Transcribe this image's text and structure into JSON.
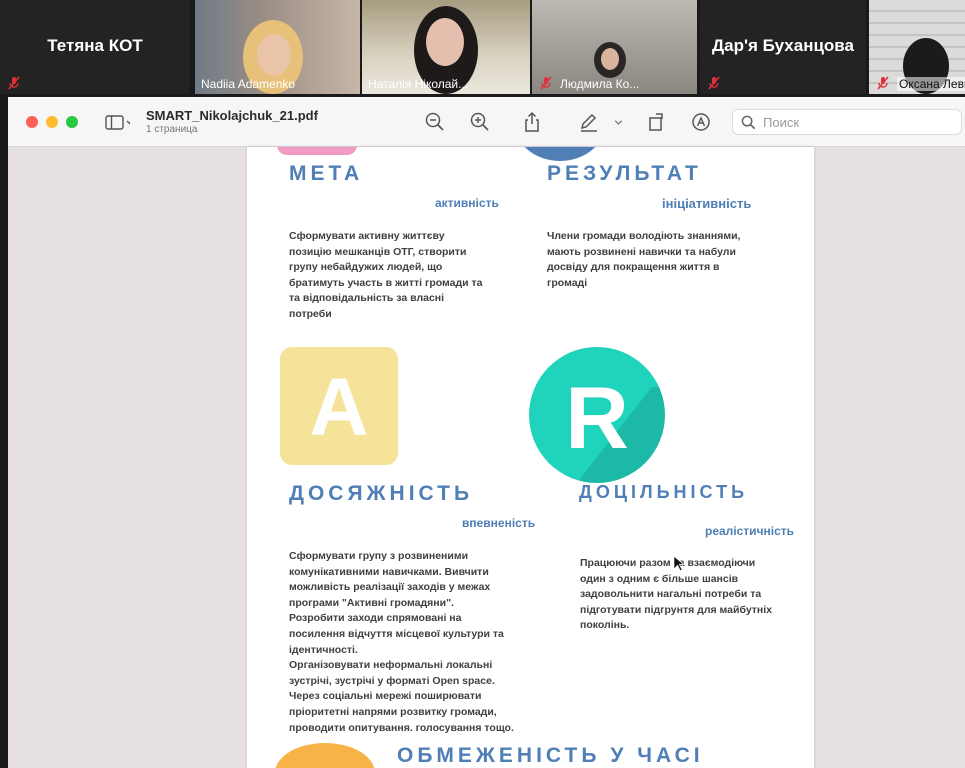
{
  "participants": [
    {
      "name": "Тетяна КОТ",
      "video": false,
      "muted": true
    },
    {
      "name": "Nadiia Adamenko",
      "video": true,
      "muted": false
    },
    {
      "name": "Наталія Ніколай...",
      "video": true,
      "muted": false,
      "active": true
    },
    {
      "name": "Людмила Ко...",
      "video": true,
      "muted": true
    },
    {
      "name": "Дар'я Буханцова",
      "video": false,
      "muted": true
    },
    {
      "name": "Оксана Леви",
      "video": true,
      "muted": true
    }
  ],
  "window": {
    "file_name": "SMART_Nikolajchuk_21.pdf",
    "page_count": "1 страница",
    "search_placeholder": "Поиск"
  },
  "doc": {
    "sections": {
      "meta": {
        "heading": "МЕТА",
        "keyword": "активність",
        "lines": [
          "Сформувати активну життєву",
          "позицію мешканців ОТГ, створити",
          "групу небайдужих людей, що",
          "братимуть участь в житті громади та",
          "та відповідальність за власні",
          "потреби"
        ]
      },
      "result": {
        "heading": "РЕЗУЛЬТАТ",
        "keyword": "ініціативність",
        "lines": [
          "Члени громади володіють знаннями,",
          "мають розвинені навички та набули",
          "досвіду для покращення життя в",
          "громаді"
        ]
      },
      "achievable": {
        "heading": "ДОСЯЖНІСТЬ",
        "keyword": "впевненість",
        "letter": "A",
        "lines": [
          "Сформувати групу з розвиненими",
          "комунікативними навичками. Вивчити",
          "можливість реалізації заходів у межах",
          "програми \"Активні громадяни\".",
          "Розробити заходи спрямовані на",
          "посилення відчуття місцевої культури та",
          "ідентичності.",
          "Організовувати неформальні локальні",
          "зустрічі, зустрічі у форматі Open space.",
          "Через соціальні мережі поширювати",
          "пріоритетні напрями розвитку громади,",
          "проводити опитування. голосування тощо."
        ]
      },
      "relevant": {
        "heading": "ДОЦІЛЬНІСТЬ",
        "keyword": "реалістичність",
        "letter": "R",
        "lines": [
          "Працюючи разом та взаємодіючи",
          "один з одним є більше шансів",
          "задовольнити нагальні потреби та",
          "підготувати підгрунтя для майбутніх",
          "поколінь."
        ]
      },
      "time": {
        "heading": "ОБМЕЖЕНІСТЬ У ЧАСІ"
      }
    }
  },
  "colors": {
    "heading_blue": "#4f7fb5",
    "tile_yellow": "#f5e39a",
    "circle_teal": "#1fd3bd",
    "mute_red": "#e0303a",
    "active_green": "#7bd34a"
  }
}
